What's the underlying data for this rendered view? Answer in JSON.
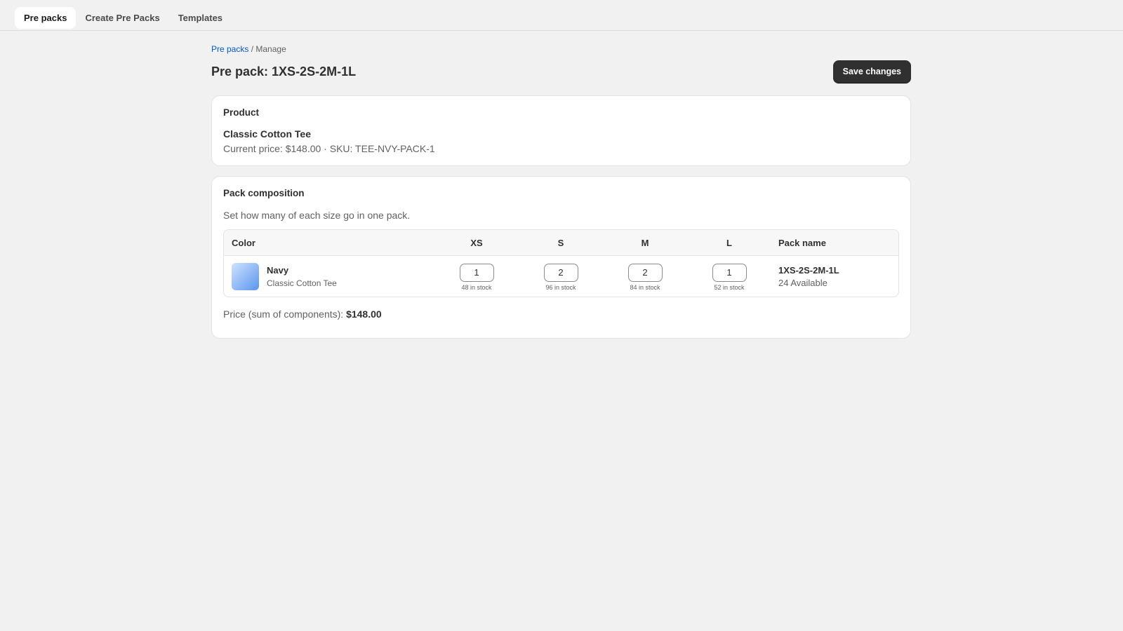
{
  "tabs": [
    {
      "label": "Pre packs",
      "active": true
    },
    {
      "label": "Create Pre Packs",
      "active": false
    },
    {
      "label": "Templates",
      "active": false
    }
  ],
  "breadcrumb": {
    "link": "Pre packs",
    "separator": " / ",
    "current": "Manage"
  },
  "page": {
    "title": "Pre pack: 1XS-2S-2M-1L",
    "save_label": "Save changes"
  },
  "product_card": {
    "title": "Product",
    "name": "Classic Cotton Tee",
    "meta": "Current price: $148.00 · SKU: TEE-NVY-PACK-1"
  },
  "composition_card": {
    "title": "Pack composition",
    "description": "Set how many of each size go in one pack.",
    "columns": {
      "color": "Color",
      "xs": "XS",
      "s": "S",
      "m": "M",
      "l": "L",
      "pack": "Pack name"
    },
    "row": {
      "color_name": "Navy",
      "product": "Classic Cotton Tee",
      "sizes": [
        {
          "size": "XS",
          "qty": "1",
          "stock": "48 in stock"
        },
        {
          "size": "S",
          "qty": "2",
          "stock": "96 in stock"
        },
        {
          "size": "M",
          "qty": "2",
          "stock": "84 in stock"
        },
        {
          "size": "L",
          "qty": "1",
          "stock": "52 in stock"
        }
      ],
      "pack_name": "1XS-2S-2M-1L",
      "available": "24 Available"
    },
    "price_label": "Price (sum of components): ",
    "price_value": "$148.00"
  },
  "colors": {
    "primary_button": "#303030",
    "link": "#005bd3",
    "background": "#f1f1f1"
  }
}
